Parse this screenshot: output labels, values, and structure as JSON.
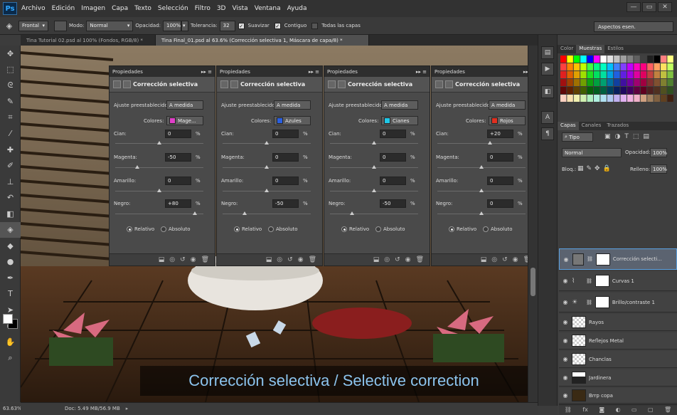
{
  "app": {
    "logo": "Ps"
  },
  "menu": [
    "Archivo",
    "Edición",
    "Imagen",
    "Capa",
    "Texto",
    "Selección",
    "Filtro",
    "3D",
    "Vista",
    "Ventana",
    "Ayuda"
  ],
  "window_controls": [
    "—",
    "▭",
    "✕"
  ],
  "options": {
    "sample_label": "Frontal",
    "mode_label": "Modo:",
    "mode_value": "Normal",
    "opacity_label": "Opacidad:",
    "opacity_value": "100%",
    "tolerance_label": "Tolerancia:",
    "tolerance_value": "32",
    "smooth_label": "Suavizar",
    "contiguous_label": "Contiguo",
    "all_layers_label": "Todas las capas",
    "workspace": "Aspectos esen."
  },
  "doc_tabs": [
    {
      "label": "Tina Tutorial 02.psd al 100% (Fondos, RGB/8) *",
      "active": false
    },
    {
      "label": "Tina Final_01.psd al 63.6% (Corrección selectiva 1, Máscara de capa/8) *",
      "active": true
    }
  ],
  "panels": [
    {
      "header": "Propiedades",
      "title": "Corrección selectiva",
      "preset_label": "Ajuste preestablecido:",
      "preset": "A medida",
      "colors_label": "Colores:",
      "color_name": "Mage...",
      "color_hex": "#e040c8",
      "cyan_label": "Cian:",
      "cyan": "0",
      "magenta_label": "Magenta:",
      "magenta": "-50",
      "yellow_label": "Amarillo:",
      "yellow": "0",
      "black_label": "Negro:",
      "black": "+80",
      "pct": "%",
      "relative": "Relativo",
      "absolute": "Absoluto"
    },
    {
      "header": "Propiedades",
      "title": "Corrección selectiva",
      "preset_label": "Ajuste preestablecido:",
      "preset": "A medida",
      "colors_label": "Colores:",
      "color_name": "Azules",
      "color_hex": "#2a5fe0",
      "cyan_label": "Cian:",
      "cyan": "0",
      "magenta_label": "Magenta:",
      "magenta": "0",
      "yellow_label": "Amarillo:",
      "yellow": "0",
      "black_label": "Negro:",
      "black": "-50",
      "pct": "%",
      "relative": "Relativo",
      "absolute": "Absoluto"
    },
    {
      "header": "Propiedades",
      "title": "Corrección selectiva",
      "preset_label": "Ajuste preestablecido:",
      "preset": "A medida",
      "colors_label": "Colores:",
      "color_name": "Cianes",
      "color_hex": "#20c8e8",
      "cyan_label": "Cian:",
      "cyan": "0",
      "magenta_label": "Magenta:",
      "magenta": "0",
      "yellow_label": "Amarillo:",
      "yellow": "0",
      "black_label": "Negro:",
      "black": "-50",
      "pct": "%",
      "relative": "Relativo",
      "absolute": "Absoluto"
    },
    {
      "header": "Propiedades",
      "title": "Corrección selectiva",
      "preset_label": "Ajuste preestablecido:",
      "preset": "A medida",
      "colors_label": "Colores:",
      "color_name": "Rojos",
      "color_hex": "#e03020",
      "cyan_label": "Cian:",
      "cyan": "+20",
      "magenta_label": "Magenta:",
      "magenta": "0",
      "yellow_label": "Amarillo:",
      "yellow": "0",
      "black_label": "Negro:",
      "black": "0",
      "pct": "%",
      "relative": "Relativo",
      "absolute": "Absoluto"
    }
  ],
  "caption": "Corrección selectiva / Selective correction",
  "status": {
    "zoom": "63.63%",
    "doc": "Doc: 5.49 MB/56.9 MB"
  },
  "swatches_tabs": [
    "Color",
    "Muestras",
    "Estilos"
  ],
  "layers_tabs": [
    "Capas",
    "Canales",
    "Trazados"
  ],
  "layers_panel": {
    "filter": "Tipo",
    "blend": "Normal",
    "opacity_label": "Opacidad:",
    "opacity": "100%",
    "lock_label": "Bloq.:",
    "fill_label": "Relleno:",
    "fill": "100%",
    "layers": [
      {
        "name": "Corrección selecti...",
        "selected": true
      },
      {
        "name": "Curvas 1",
        "selected": false
      },
      {
        "name": "Brillo/contraste 1",
        "selected": false
      },
      {
        "name": "Rayos",
        "selected": false
      },
      {
        "name": "Reflejos Metal",
        "selected": false
      },
      {
        "name": "Chanclas",
        "selected": false
      },
      {
        "name": "Jardinera",
        "selected": false
      },
      {
        "name": "Brrp copa",
        "selected": false
      }
    ]
  }
}
